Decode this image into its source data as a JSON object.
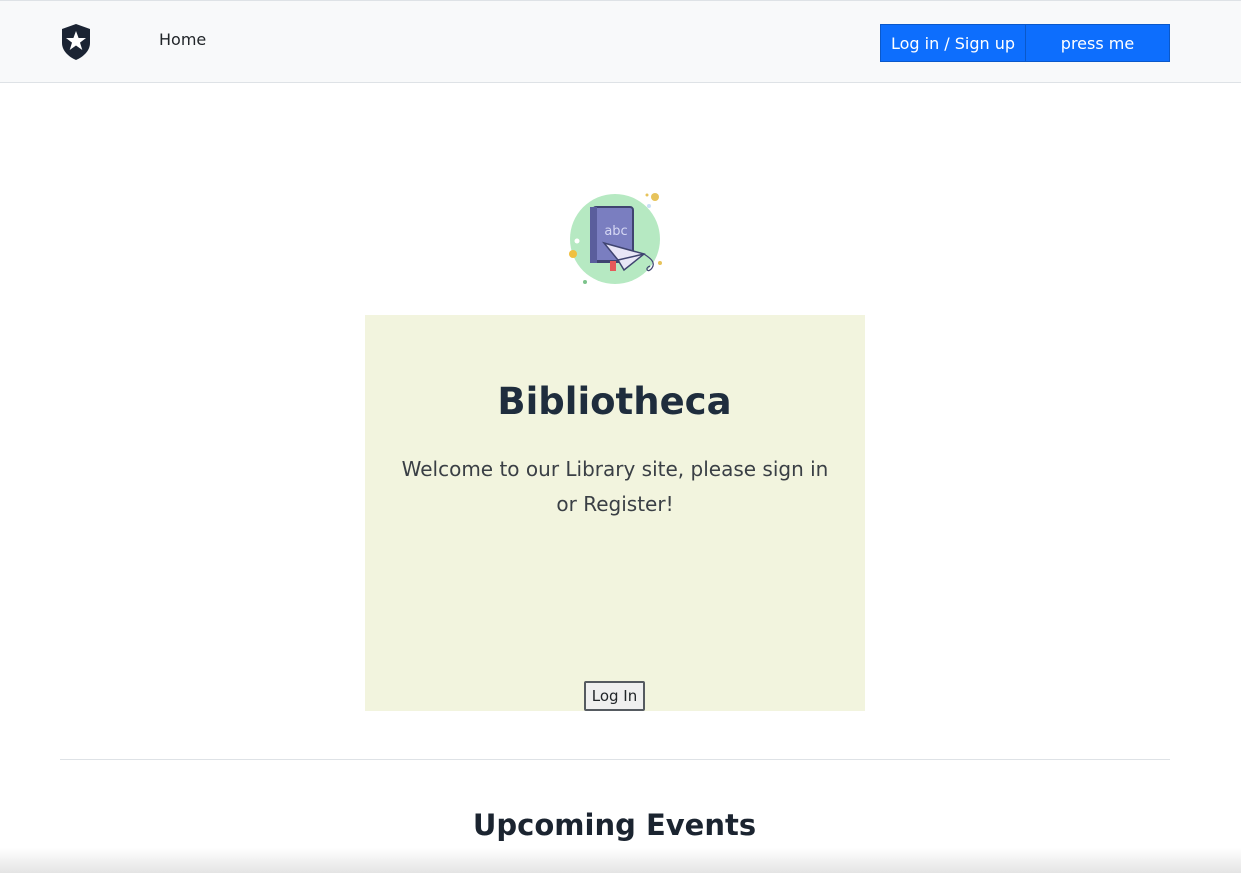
{
  "navbar": {
    "brand_icon": "shield-star-icon",
    "home_label": "Home",
    "login_signup_label": "Log in / Sign up",
    "press_me_label": "press me",
    "accent_color": "#0d6efd"
  },
  "hero": {
    "image_icon": "book-paper-plane-icon",
    "title": "Bibliotheca",
    "text": "Welcome to our Library site, please sign in or Register!",
    "login_button_label": "Log In",
    "card_color": "#f2f4de"
  },
  "events": {
    "title": "Upcoming Events"
  }
}
